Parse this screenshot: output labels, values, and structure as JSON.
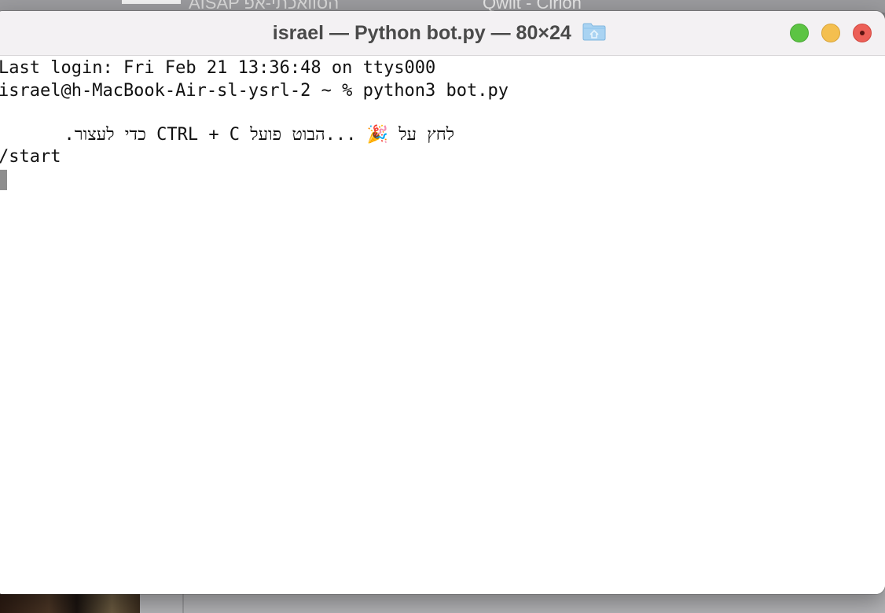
{
  "background": {
    "left_window_title": "AISAP הסוואכתי-אפ",
    "right_window_title": "Qwilt - Cirion"
  },
  "window": {
    "title": "israel — Python bot.py — 80×24",
    "title_icon": "folder-home-icon",
    "controls": {
      "green": "#5cc443",
      "yellow": "#f4bf4f",
      "red": "#ec5f57"
    }
  },
  "terminal": {
    "lines": [
      "Last login: Fri Feb 21 13:36:48 on ttys000",
      "israel@h-MacBook-Air-sl-ysrl-2 ~ % python3 bot.py",
      "",
      "לחץ על 🎉 ...הבוט פועל CTRL + C כדי לעצור.",
      "/start"
    ],
    "cursor_color": "#8e8e8e"
  }
}
